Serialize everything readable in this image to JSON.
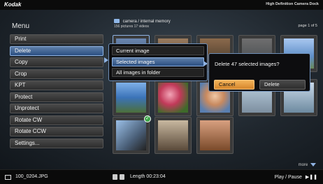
{
  "header": {
    "brand": "Kodak",
    "dock_name": "High Definition Camera Dock"
  },
  "menu": {
    "title": "Menu",
    "items": [
      {
        "label": "Print"
      },
      {
        "label": "Delete"
      },
      {
        "label": "Copy"
      },
      {
        "label": "Crop"
      },
      {
        "label": "KPT"
      },
      {
        "label": "Protect"
      },
      {
        "label": "Unprotect"
      },
      {
        "label": "Rotate CW"
      },
      {
        "label": "Rotate CCW"
      },
      {
        "label": "Settings..."
      }
    ],
    "selected_index": 1
  },
  "location": {
    "path": "camera / internal memory",
    "counts": "156 pictures  17 videos",
    "page": "page 1 of 5"
  },
  "submenu": {
    "items": [
      {
        "label": "Current image"
      },
      {
        "label": "Selected images"
      },
      {
        "label": "All images in folder"
      }
    ],
    "selected_index": 1
  },
  "dialog": {
    "message": "Delete 47 selected images?",
    "cancel_label": "Cancel",
    "delete_label": "Delete",
    "focused": "cancel"
  },
  "footer": {
    "more": "more",
    "filename": "100_0204.JPG",
    "length": "Length  00:23:04",
    "playpause": "Play / Pause"
  },
  "colors": {
    "accent": "#8fb3e3",
    "highlight": "#2b4f82",
    "cancel_orange": "#e39a3a"
  }
}
